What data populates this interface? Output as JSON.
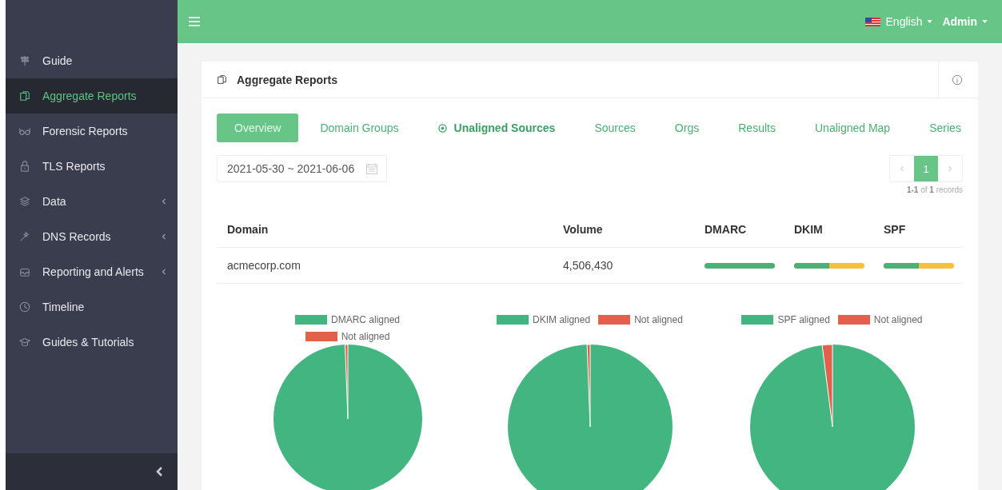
{
  "sidebar": {
    "items": [
      {
        "label": "Guide",
        "selected": false,
        "expandable": false
      },
      {
        "label": "Aggregate Reports",
        "selected": true,
        "expandable": false
      },
      {
        "label": "Forensic Reports",
        "selected": false,
        "expandable": false
      },
      {
        "label": "TLS Reports",
        "selected": false,
        "expandable": false
      },
      {
        "label": "Data",
        "selected": false,
        "expandable": true
      },
      {
        "label": "DNS Records",
        "selected": false,
        "expandable": true
      },
      {
        "label": "Reporting and Alerts",
        "selected": false,
        "expandable": true
      },
      {
        "label": "Timeline",
        "selected": false,
        "expandable": false
      },
      {
        "label": "Guides & Tutorials",
        "selected": false,
        "expandable": false
      }
    ]
  },
  "topbar": {
    "language": "English",
    "user": "Admin"
  },
  "card": {
    "title": "Aggregate Reports",
    "tabs": [
      {
        "label": "Overview",
        "selected": true,
        "kind": "plain"
      },
      {
        "label": "Domain Groups",
        "selected": false,
        "kind": "plain"
      },
      {
        "label": "Unaligned Sources",
        "selected": false,
        "kind": "featured"
      },
      {
        "label": "Sources",
        "selected": false,
        "kind": "plain"
      },
      {
        "label": "Orgs",
        "selected": false,
        "kind": "plain"
      },
      {
        "label": "Results",
        "selected": false,
        "kind": "plain"
      },
      {
        "label": "Unaligned Map",
        "selected": false,
        "kind": "plain"
      },
      {
        "label": "Series",
        "selected": false,
        "kind": "plain"
      }
    ],
    "date_range": "2021-05-30 ~ 2021-06-06",
    "pagination": {
      "page": "1",
      "summary": "**1-1** of **1** records"
    },
    "table": {
      "columns": [
        "Domain",
        "Volume",
        "DMARC",
        "DKIM",
        "SPF"
      ],
      "rows": [
        {
          "domain": "acmecorp.com",
          "volume": "4,506,430",
          "dmarc": {
            "level": 1
          },
          "dkim": {
            "level": 0.5
          },
          "spf": {
            "level": 0.5
          }
        }
      ]
    },
    "pies": [
      {
        "legend": [
          "DMARC aligned",
          "Not aligned"
        ]
      },
      {
        "legend": [
          "DKIM aligned",
          "Not aligned"
        ]
      },
      {
        "legend": [
          "SPF aligned",
          "Not aligned"
        ]
      }
    ]
  }
}
